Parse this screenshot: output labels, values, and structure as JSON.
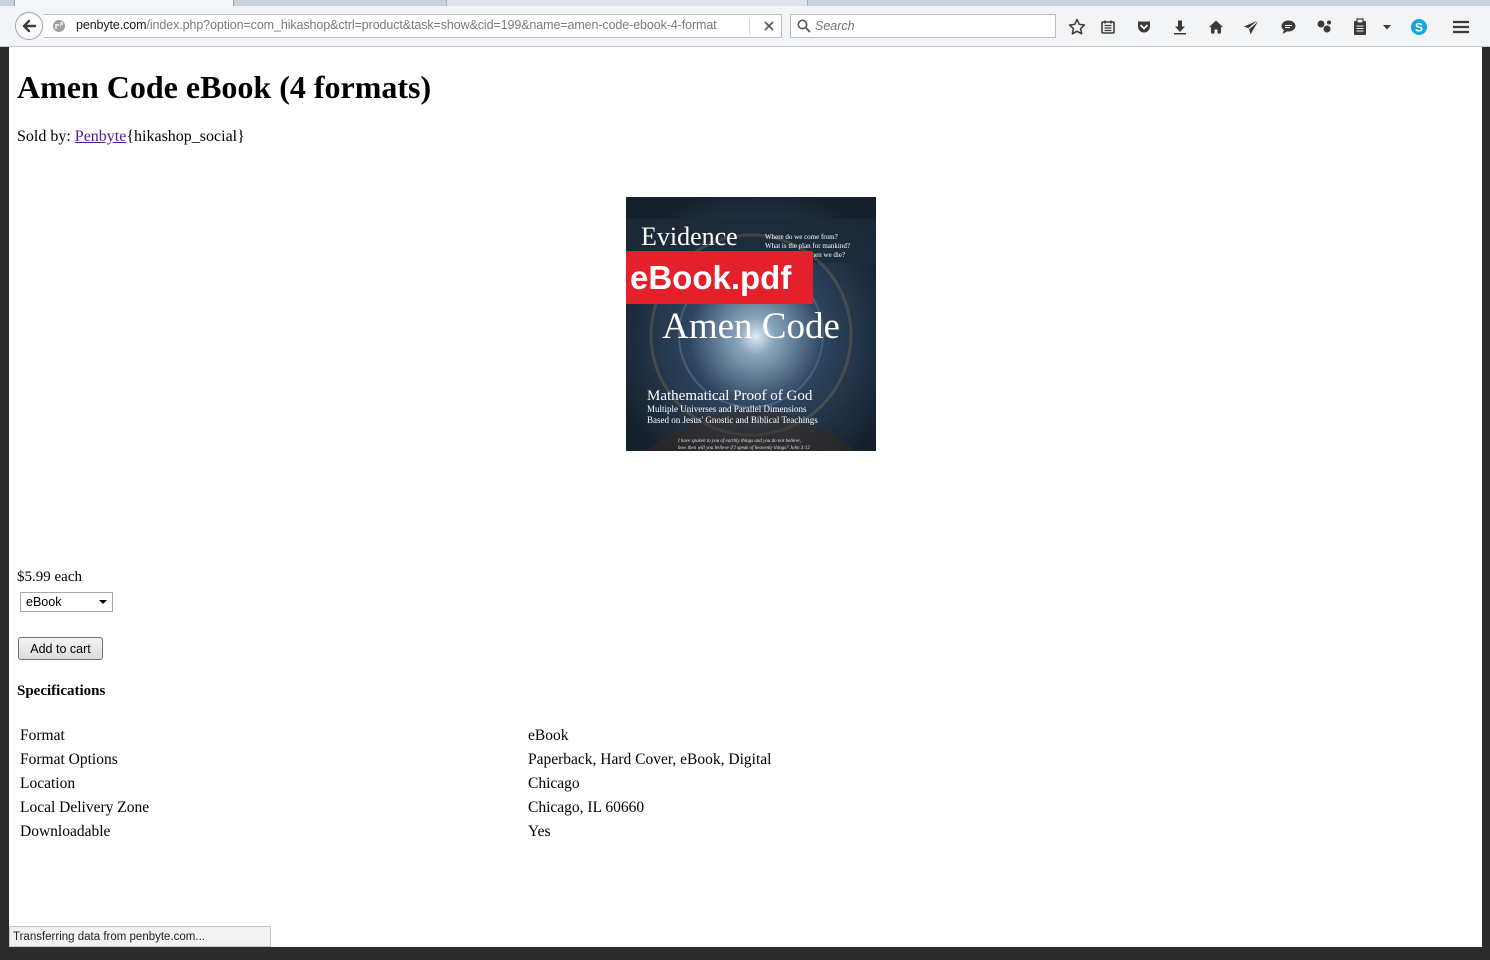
{
  "browser": {
    "url_host": "penbyte.com",
    "url_path": "/index.php?option=com_hikashop&ctrl=product&task=show&cid=199&name=amen-code-ebook-4-format",
    "search_placeholder": "Search",
    "toolbar_icons": [
      "star-icon",
      "reading-list-icon",
      "pocket-icon",
      "download-icon",
      "home-icon",
      "send-icon",
      "chat-icon",
      "share-icon",
      "clipboard-icon",
      "dropdown-icon",
      "skype-icon",
      "menu-icon"
    ],
    "status_text": "Transferring data from penbyte.com..."
  },
  "product": {
    "title": "Amen Code eBook (4 formats)",
    "sold_by_label": "Sold by: ",
    "seller": "Penbyte",
    "social_placeholder": "{hikashop_social}",
    "image": {
      "badge": "eBook.pdf",
      "heading": "Evidence",
      "questions": [
        "Where do we come from?",
        "What is the plan for mankind?",
        "What happens when we die?"
      ],
      "book_title": "Amen Code",
      "subtitle": "Mathematical Proof of God",
      "tagline1": "Multiple Universes and Parallel Dimensions",
      "tagline2": "Based on Jesus' Gnostic and Biblical Teachings",
      "quote1": "I have spoken to you of earthly things and you do not believe,",
      "quote2": "how then will you believe if I speak of heavenly things? John 3:12"
    },
    "price": "$5.99 each",
    "format_selected": "eBook",
    "add_to_cart": "Add to cart",
    "specs_heading": "Specifications",
    "specs": [
      {
        "key": "Format",
        "value": "eBook"
      },
      {
        "key": "Format Options",
        "value": "Paperback, Hard Cover, eBook, Digital"
      },
      {
        "key": "Location",
        "value": "Chicago"
      },
      {
        "key": "Local Delivery Zone",
        "value": "Chicago, IL 60660"
      },
      {
        "key": "Downloadable",
        "value": "Yes"
      }
    ]
  },
  "colors": {
    "link": "#551a8b",
    "badge_red": "#e3202b",
    "cover_dark": "#1c2a3a"
  }
}
